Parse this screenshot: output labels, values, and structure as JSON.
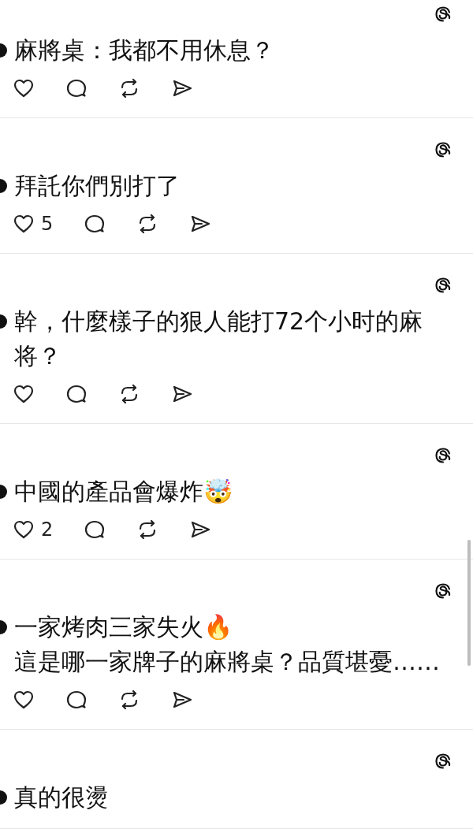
{
  "posts": [
    {
      "text": "麻將桌：我都不用休息？",
      "actions": [
        {
          "kind": "like"
        },
        {
          "kind": "reply"
        },
        {
          "kind": "repost"
        },
        {
          "kind": "share"
        }
      ]
    },
    {
      "text": "拜託你們別打了",
      "actions": [
        {
          "kind": "like",
          "count": "5"
        },
        {
          "kind": "reply"
        },
        {
          "kind": "repost"
        },
        {
          "kind": "share"
        }
      ]
    },
    {
      "text": "幹，什麼樣子的狠人能打72个小时的麻将？",
      "actions": [
        {
          "kind": "like"
        },
        {
          "kind": "reply"
        },
        {
          "kind": "repost"
        },
        {
          "kind": "share"
        }
      ]
    },
    {
      "text": "中國的產品會爆炸🤯",
      "actions": [
        {
          "kind": "like",
          "count": "2"
        },
        {
          "kind": "reply"
        },
        {
          "kind": "repost"
        },
        {
          "kind": "share"
        }
      ]
    },
    {
      "text": "一家烤肉三家失火🔥\n這是哪一家牌子的麻將桌？品質堪憂……",
      "actions": [
        {
          "kind": "like"
        },
        {
          "kind": "reply"
        },
        {
          "kind": "repost"
        },
        {
          "kind": "share"
        }
      ]
    },
    {
      "text": "真的很燙"
    }
  ]
}
